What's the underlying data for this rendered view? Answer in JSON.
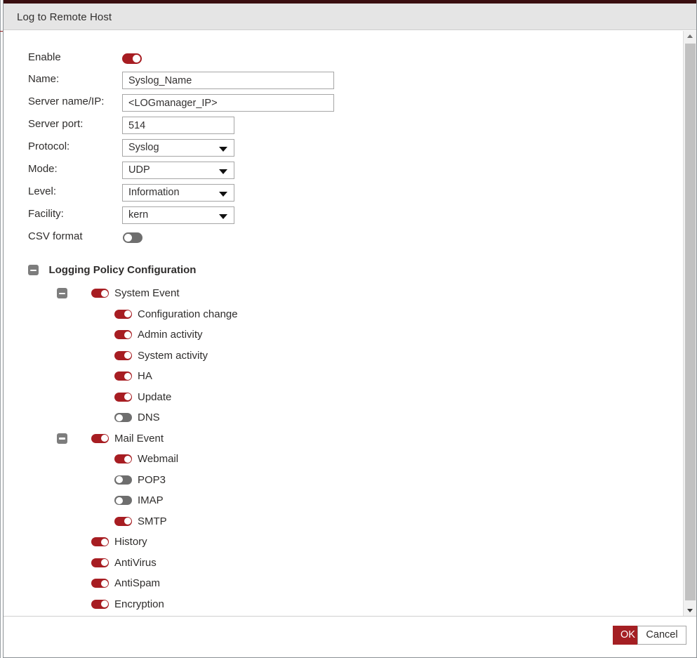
{
  "dialog": {
    "title": "Log to Remote Host",
    "accent_color": "#3a0f10",
    "brand_color": "#a41f23",
    "toggle_on_color": "#a71d22",
    "toggle_off_color": "#6e6e6e"
  },
  "form": {
    "enable": {
      "label": "Enable",
      "state": "on"
    },
    "name": {
      "label": "Name:",
      "value": "Syslog_Name",
      "placeholder": ""
    },
    "server_name_ip": {
      "label": "Server name/IP:",
      "value": "<LOGmanager_IP>",
      "placeholder": ""
    },
    "server_port": {
      "label": "Server port:",
      "value": "514",
      "placeholder": ""
    },
    "protocol": {
      "label": "Protocol:",
      "value": "Syslog"
    },
    "mode": {
      "label": "Mode:",
      "value": "UDP"
    },
    "level": {
      "label": "Level:",
      "value": "Information"
    },
    "facility": {
      "label": "Facility:",
      "value": "kern"
    },
    "csv_format": {
      "label": "CSV format",
      "state": "off"
    }
  },
  "tree": {
    "root": {
      "label": "Logging Policy Configuration",
      "expander": "minus"
    },
    "nodes": [
      {
        "label": "System Event",
        "state": "on",
        "level": 1,
        "expander": "minus"
      },
      {
        "label": "Configuration change",
        "state": "on",
        "level": 2,
        "expander": "none"
      },
      {
        "label": "Admin activity",
        "state": "on",
        "level": 2,
        "expander": "none"
      },
      {
        "label": "System activity",
        "state": "on",
        "level": 2,
        "expander": "none"
      },
      {
        "label": "HA",
        "state": "on",
        "level": 2,
        "expander": "none"
      },
      {
        "label": "Update",
        "state": "on",
        "level": 2,
        "expander": "none"
      },
      {
        "label": "DNS",
        "state": "off",
        "level": 2,
        "expander": "none"
      },
      {
        "label": "Mail Event",
        "state": "on",
        "level": 1,
        "expander": "minus"
      },
      {
        "label": "Webmail",
        "state": "on",
        "level": 2,
        "expander": "none"
      },
      {
        "label": "POP3",
        "state": "off",
        "level": 2,
        "expander": "none"
      },
      {
        "label": "IMAP",
        "state": "off",
        "level": 2,
        "expander": "none"
      },
      {
        "label": "SMTP",
        "state": "on",
        "level": 2,
        "expander": "none"
      },
      {
        "label": "History",
        "state": "on",
        "level": 1.5,
        "expander": "none"
      },
      {
        "label": "AntiVirus",
        "state": "on",
        "level": 1.5,
        "expander": "none"
      },
      {
        "label": "AntiSpam",
        "state": "on",
        "level": 1.5,
        "expander": "none"
      },
      {
        "label": "Encryption",
        "state": "on",
        "level": 1.5,
        "expander": "none"
      }
    ]
  },
  "footer": {
    "ok_label": "OK",
    "cancel_label": "Cancel"
  },
  "scrollbar": {
    "up_icon": "triangle-up-icon",
    "down_icon": "triangle-down-icon"
  }
}
